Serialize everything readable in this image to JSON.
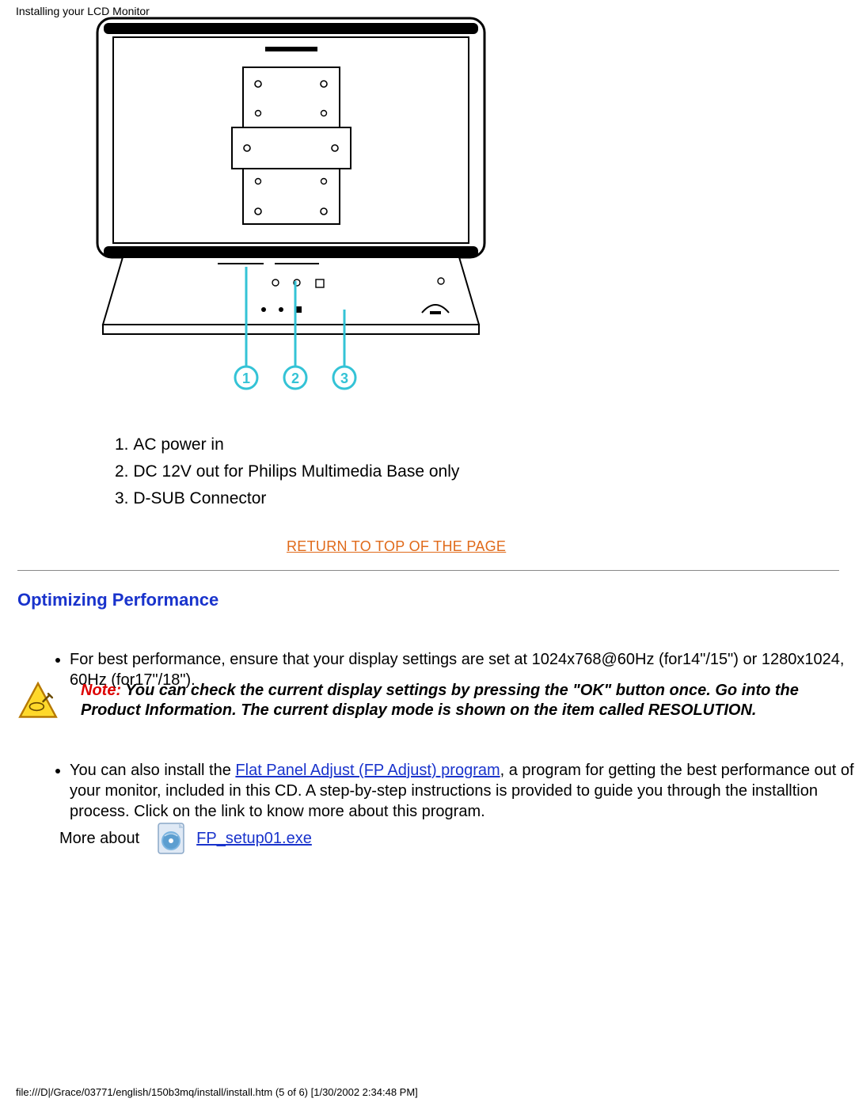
{
  "header": {
    "title": "Installing your LCD Monitor"
  },
  "diagram": {
    "callouts": [
      "1",
      "2",
      "3"
    ]
  },
  "legend": {
    "items": [
      "AC power in",
      "DC 12V out for Philips Multimedia Base only",
      "D-SUB Connector"
    ]
  },
  "return_link": "RETURN TO TOP OF THE PAGE",
  "section": {
    "heading": "Optimizing Performance"
  },
  "bullet1": "For best performance, ensure that your display settings are set at 1024x768@60Hz (for14\"/15\") or 1280x1024, 60Hz (for17\"/18\").",
  "note": {
    "label": "Note:",
    "text": " You can check the current display settings by pressing the \"OK\" button once. Go into the Product Information. The current display mode is shown on the item called RESOLUTION."
  },
  "bullet2_pre": "You can also install the ",
  "bullet2_link": "Flat Panel Adjust (FP Adjust) program",
  "bullet2_post": ", a program for getting the best performance out of your monitor, included in this CD. A step-by-step instructions is provided to guide you through the installtion process. Click on the link to know more about this program.",
  "more_about": "More about",
  "fp_setup": "FP_setup01.exe",
  "footer": "file:///D|/Grace/03771/english/150b3mq/install/install.htm (5 of 6) [1/30/2002 2:34:48 PM]"
}
